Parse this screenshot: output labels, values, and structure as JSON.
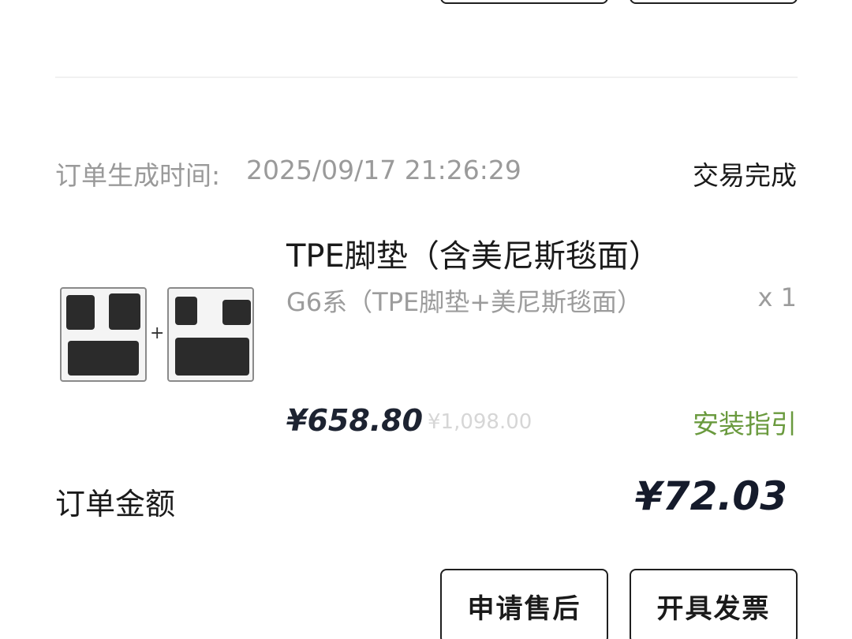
{
  "top_buttons": {
    "left_label": "",
    "right_label": ""
  },
  "order": {
    "time_label": "订单生成时间:",
    "time_value": "2025/09/17 21:26:29",
    "status": "交易完成"
  },
  "product": {
    "title": "TPE脚垫（含美尼斯毯面）",
    "spec": "G6系（TPE脚垫+美尼斯毯面）",
    "quantity": "x 1",
    "price": "¥658.80",
    "original_price": "¥1,098.00",
    "install_guide": "安装指引",
    "thumbnail_plus": "+"
  },
  "summary": {
    "amount_label": "订单金额",
    "amount_value": "¥72.03"
  },
  "actions": {
    "after_sale": "申请售后",
    "invoice": "开具发票"
  },
  "colors": {
    "accent_green": "#6a9a3e",
    "price_dark": "#1d2331",
    "muted_gray": "#9a9a9a"
  }
}
